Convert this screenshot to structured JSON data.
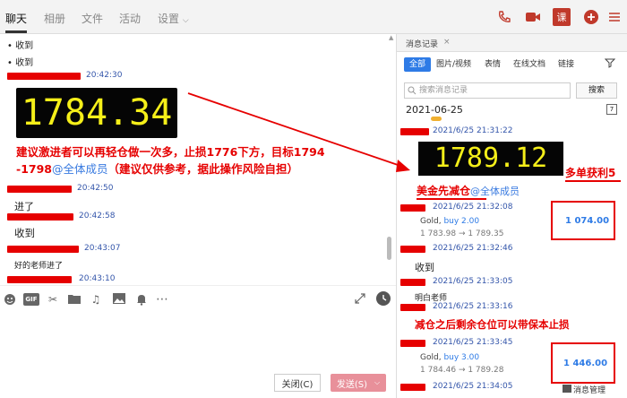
{
  "nav": {
    "tabs": [
      "聊天",
      "相册",
      "文件",
      "活动",
      "设置"
    ],
    "settings_chevron": "chevron-down-icon",
    "icons": [
      "phone-icon",
      "video-icon",
      "class-icon",
      "plus-icon",
      "more-icon"
    ],
    "class_label": "课"
  },
  "chat": {
    "bullets": [
      "收到",
      "收到"
    ],
    "msg1_time": "20:42:30",
    "quote_big": "1784.34",
    "red_line1": "建议激进者可以再轻仓做一次多，止损1776下方，目标1794",
    "red_line2_a": "-1798",
    "red_line2_at": "@全体成员",
    "red_line2_b": "（建议仅供参考，据此操作风险自担）",
    "msg2_time": "20:42:50",
    "msg2_text": "进了",
    "msg3_time": "20:42:58",
    "msg3_text": "收到",
    "msg4_time": "20:43:07",
    "msg4_text": "好的老师进了",
    "msg5_time": "20:43:10"
  },
  "toolbar": {
    "icons": [
      "emoji-icon",
      "gif-icon",
      "scissors-icon",
      "folder-icon",
      "music-icon",
      "image-icon",
      "bell-icon",
      "more-icon"
    ],
    "gif_label": "GIF",
    "close_label": "关闭(C)",
    "send_label": "发送(S)"
  },
  "panel": {
    "title": "消息记录",
    "close_glyph": "×",
    "filters": [
      "全部",
      "图片/视频",
      "表情",
      "在线文档",
      "链接"
    ],
    "search_placeholder": "搜索消息记录",
    "search_button": "搜索",
    "date": "2021-06-25",
    "t1": "2021/6/25 21:31:22",
    "big": "1789.12",
    "profit_note": "多单获利5",
    "reduce_note": "美金先减仓",
    "reduce_at": "@全体成员",
    "t2": "2021/6/25 21:32:08",
    "trade1_symbol": "Gold,",
    "trade1_side": "buy 2.00",
    "trade1_prices": "1 783.98 → 1 789.35",
    "trade1_profit": "1 074.00",
    "t3": "2021/6/25 21:32:46",
    "p_msg1": "收到",
    "t4": "2021/6/25 21:33:05",
    "p_msg2": "明白老师",
    "t5": "2021/6/25 21:33:16",
    "p_red": "减仓之后剩余仓位可以带保本止损",
    "t6": "2021/6/25 21:33:45",
    "trade2_symbol": "Gold,",
    "trade2_side": "buy 3.00",
    "trade2_prices": "1 784.46 → 1 789.28",
    "trade2_profit": "1 446.00",
    "t7": "2021/6/25 21:34:05",
    "msg_manager": "消息管理"
  }
}
